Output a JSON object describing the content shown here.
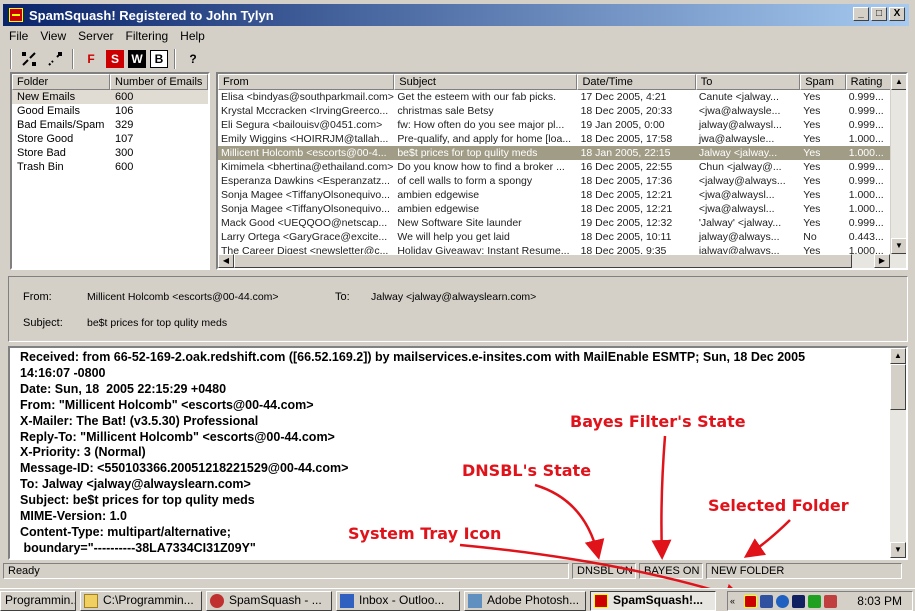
{
  "window": {
    "title": "SpamSquash!  Registered to John Tylyn",
    "buttons": {
      "minimize": "_",
      "maximize": "□",
      "close": "X"
    }
  },
  "menu": [
    "File",
    "View",
    "Server",
    "Filtering",
    "Help"
  ],
  "toolbar": {
    "f_label": "F",
    "s_label": "S",
    "w_label": "W",
    "b_label": "B",
    "help_label": "?"
  },
  "folders": {
    "headers": [
      "Folder",
      "Number of Emails"
    ],
    "rows": [
      {
        "name": "New Emails",
        "count": "600",
        "selected": true
      },
      {
        "name": "Good Emails",
        "count": "106"
      },
      {
        "name": "Bad Emails/Spam",
        "count": "329"
      },
      {
        "name": "Store Good",
        "count": "107"
      },
      {
        "name": "Store Bad",
        "count": "300"
      },
      {
        "name": "Trash Bin",
        "count": "600"
      }
    ]
  },
  "messages": {
    "headers": [
      "From",
      "Subject",
      "Date/Time",
      "To",
      "Spam",
      "Rating"
    ],
    "rows": [
      [
        "Elisa <bindyas@southparkmail.com>",
        "Get the esteem with our fab picks.",
        "17 Dec 2005, 4:21",
        "Canute <jalway...",
        "Yes",
        "0.999..."
      ],
      [
        "Krystal Mccracken <IrvingGreerco...",
        "christmas sale Betsy",
        "18 Dec 2005, 20:33",
        "<jwa@alwaysle...",
        "Yes",
        "0.999..."
      ],
      [
        "Eli Segura <bailouisv@0451.com>",
        "fw: How often do you see major pl...",
        "19 Jan 2005, 0:00",
        "jalway@alwaysl...",
        "Yes",
        "0.999..."
      ],
      [
        "Emily Wiggins <HOIRRJM@tallah...",
        "Pre-qualify, and apply for home [loa...",
        "18 Dec 2005, 17:58",
        "jwa@alwaysle...",
        "Yes",
        "1.000..."
      ],
      [
        "Millicent Holcomb <escorts@00-4...",
        "be$t prices for top qulity meds",
        "18 Jan 2005, 22:15",
        "Jalway <jalway...",
        "Yes",
        "1.000..."
      ],
      [
        "Kimimela <bhertina@ethailand.com>",
        "Do you know how to find a broker ...",
        "16 Dec 2005, 22:55",
        "Chun <jalway@...",
        "Yes",
        "0.999..."
      ],
      [
        "Esperanza Dawkins <Esperanzatz...",
        "of cell walls to form a spongy",
        "18 Dec 2005, 17:36",
        "<jalway@always...",
        "Yes",
        "0.999..."
      ],
      [
        "Sonja Magee <TiffanyOlsonequivo...",
        "ambien edgewise",
        "18 Dec 2005, 12:21",
        "<jwa@alwaysl...",
        "Yes",
        "1.000..."
      ],
      [
        "Sonja Magee <TiffanyOlsonequivo...",
        "ambien edgewise",
        "18 Dec 2005, 12:21",
        "<jwa@alwaysl...",
        "Yes",
        "1.000..."
      ],
      [
        "Mack Good <UEQQOO@netscap...",
        "New Software Site launder",
        "19 Dec 2005, 12:32",
        "'Jalway' <jalway...",
        "Yes",
        "0.999..."
      ],
      [
        "Larry Ortega <GaryGrace@excite...",
        "We will help you get laid",
        "18 Dec 2005, 10:11",
        "jalway@always...",
        "No",
        "0.443..."
      ],
      [
        "The Career Digest <newsletter@c...",
        "Holiday Giveaway: Instant Resume...",
        "18 Dec 2005, 9:35",
        "jalway@always...",
        "Yes",
        "1.000..."
      ]
    ],
    "selected_index": 4
  },
  "preview": {
    "from_label": "From:",
    "from_value": "Millicent Holcomb <escorts@00-44.com>",
    "to_label": "To:",
    "to_value": "Jalway <jalway@alwayslearn.com>",
    "subject_label": "Subject:",
    "subject_value": "be$t prices for top qulity meds"
  },
  "body_lines": [
    "Received: from 66-52-169-2.oak.redshift.com ([66.52.169.2]) by mailservices.e-insites.com with MailEnable ESMTP; Sun, 18 Dec 2005",
    "14:16:07 -0800",
    "Date: Sun, 18  2005 22:15:29 +0480",
    "From: \"Millicent Holcomb\" <escorts@00-44.com>",
    "X-Mailer: The Bat! (v3.5.30) Professional",
    "Reply-To: \"Millicent Holcomb\" <escorts@00-44.com>",
    "X-Priority: 3 (Normal)",
    "Message-ID: <550103366.20051218221529@00-44.com>",
    "To: Jalway <jalway@alwayslearn.com>",
    "Subject: be$t prices for top qulity meds",
    "MIME-Version: 1.0",
    "Content-Type: multipart/alternative;",
    " boundary=\"----------38LA7334CI31Z09Y\""
  ],
  "status": {
    "ready": "Ready",
    "dnsbl": "DNSBL ON",
    "bayes": "BAYES ON",
    "folder": "NEW FOLDER"
  },
  "annotations": {
    "bayes": "Bayes Filter's State",
    "dnsbl": "DNSBL's State",
    "folder": "Selected Folder",
    "tray": "System Tray Icon"
  },
  "taskbar": {
    "tasks": [
      "Programmin...",
      "C:\\Programmin...",
      "SpamSquash - ...",
      "Inbox - Outloo...",
      "Adobe Photosh...",
      "SpamSquash!..."
    ],
    "clock": "8:03 PM"
  },
  "colors": {
    "title_gradient_start": "#0a246a",
    "selected_row": "#a19c86",
    "annotation_red": "#e0121a"
  }
}
